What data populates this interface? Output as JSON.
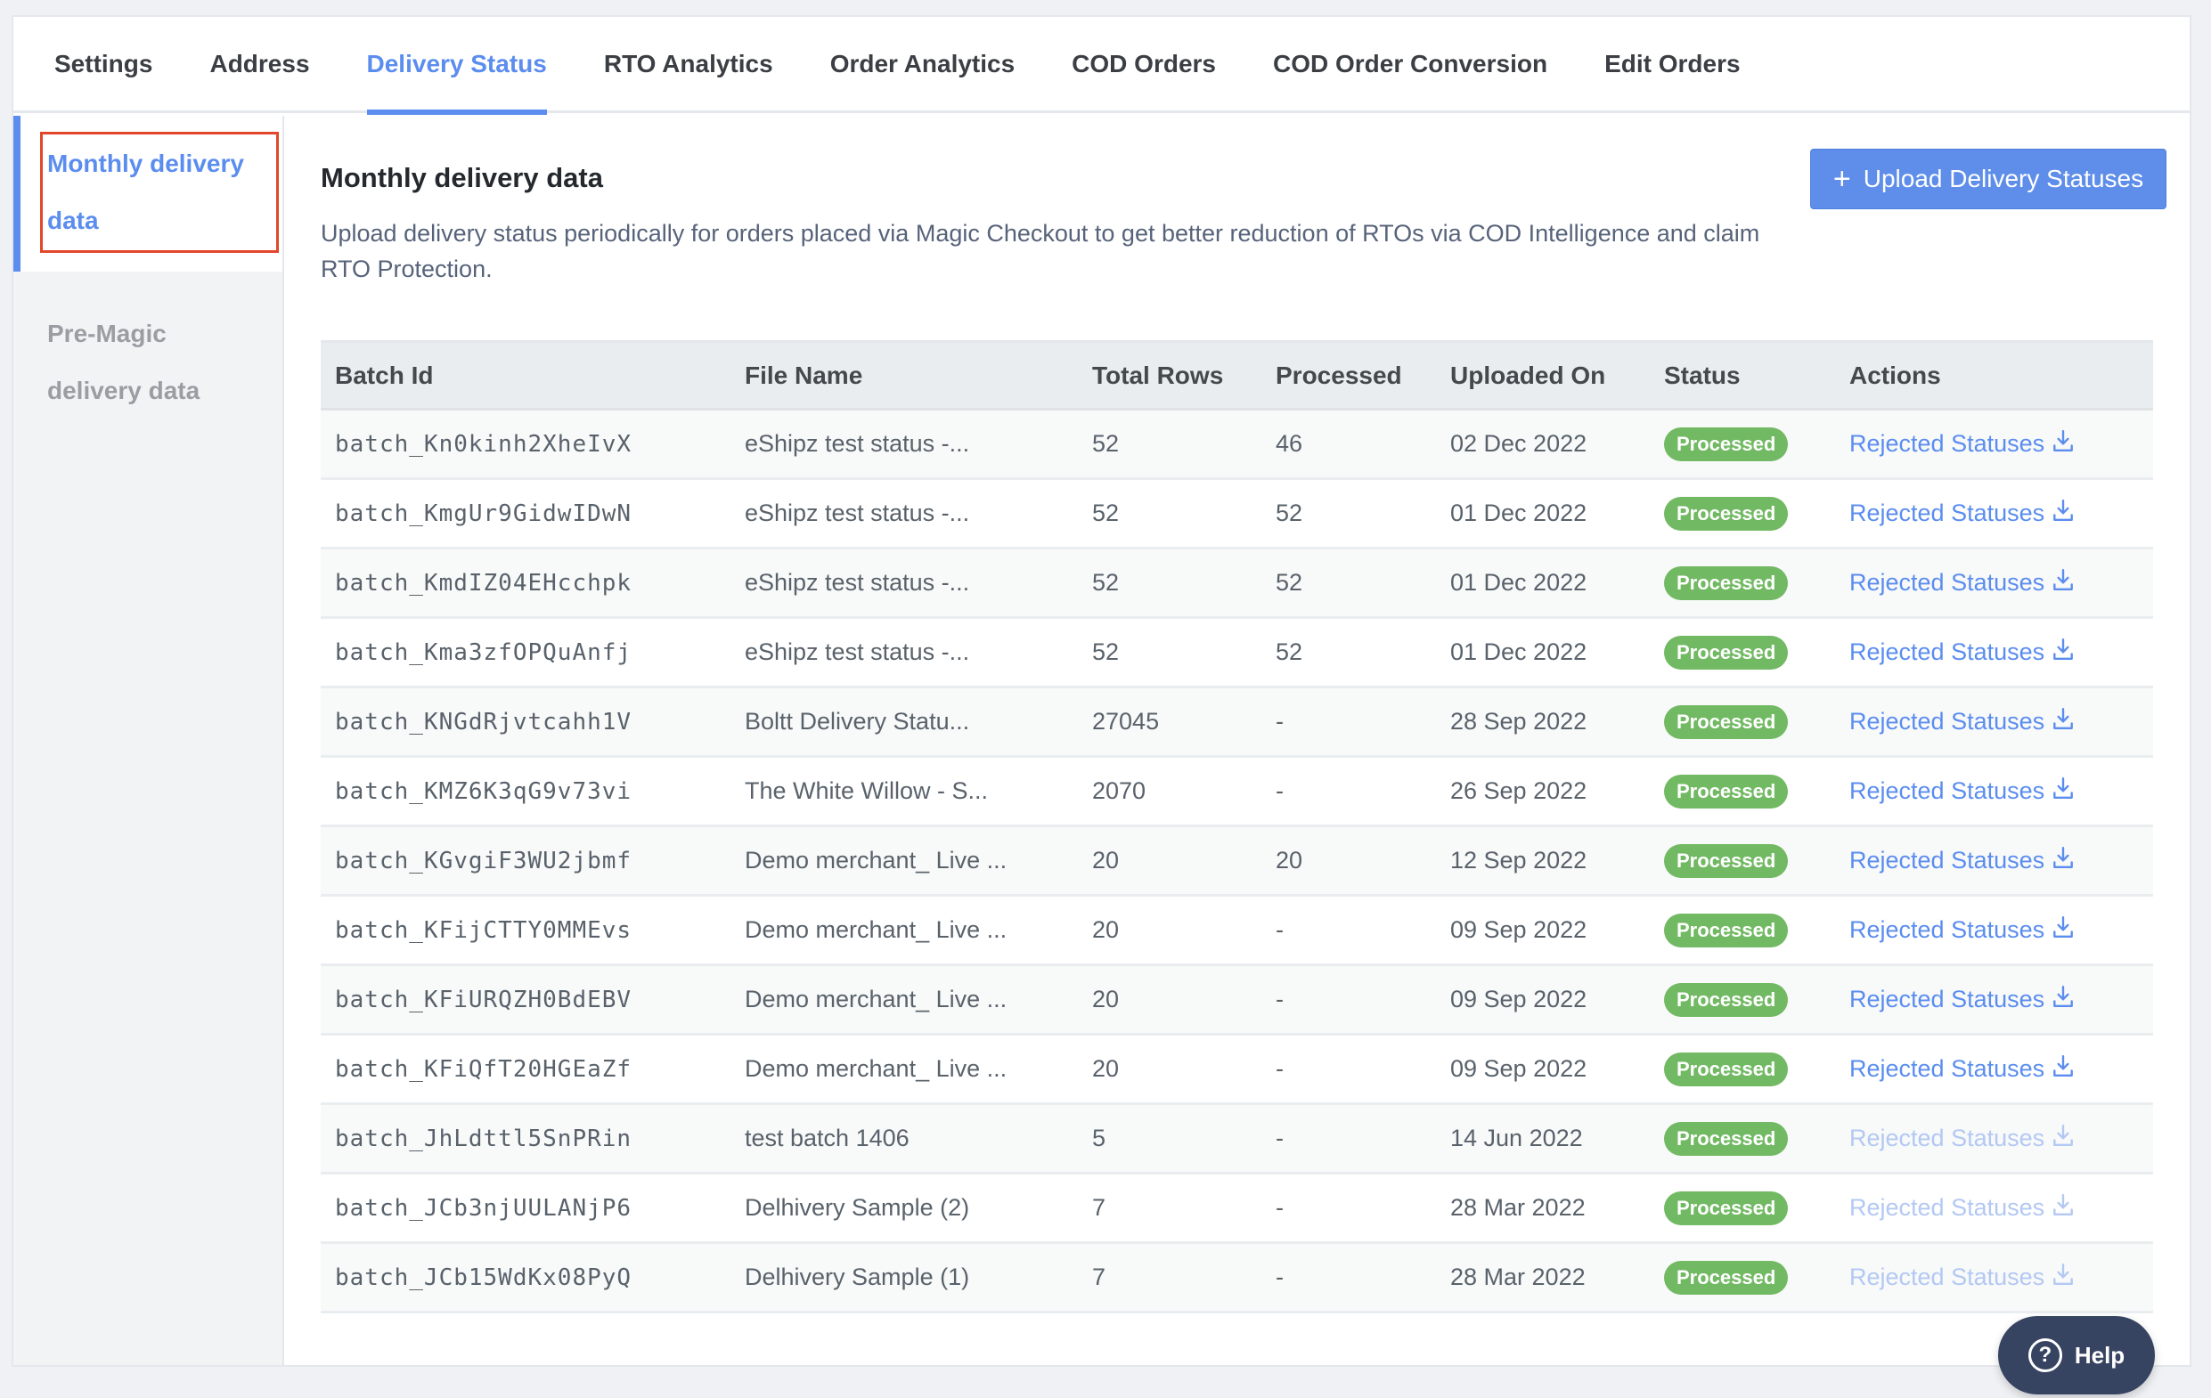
{
  "tabs": [
    {
      "label": "Settings",
      "active": false
    },
    {
      "label": "Address",
      "active": false
    },
    {
      "label": "Delivery Status",
      "active": true
    },
    {
      "label": "RTO Analytics",
      "active": false
    },
    {
      "label": "Order Analytics",
      "active": false
    },
    {
      "label": "COD Orders",
      "active": false
    },
    {
      "label": "COD Order Conversion",
      "active": false
    },
    {
      "label": "Edit Orders",
      "active": false
    }
  ],
  "sidebar": {
    "items": [
      {
        "label_line1": "Monthly delivery",
        "label_line2": "data",
        "active": true
      },
      {
        "label_line1": "Pre-Magic",
        "label_line2": "delivery data",
        "active": false
      }
    ]
  },
  "main": {
    "title": "Monthly delivery data",
    "description": "Upload delivery status periodically for orders placed via Magic Checkout to get better reduction of RTOs via COD Intelligence and claim RTO Protection.",
    "upload_button": {
      "icon": "plus-icon",
      "label": "Upload Delivery Statuses"
    },
    "table": {
      "columns": [
        "Batch Id",
        "File Name",
        "Total Rows",
        "Processed",
        "Uploaded On",
        "Status",
        "Actions"
      ],
      "rows": [
        {
          "batch_id": "batch_Kn0kinh2XheIvX",
          "file_name": "eShipz test status -...",
          "total_rows": "52",
          "processed": "46",
          "uploaded_on": "02 Dec 2022",
          "status": "Processed",
          "action": "Rejected Statuses",
          "action_enabled": true
        },
        {
          "batch_id": "batch_KmgUr9GidwIDwN",
          "file_name": "eShipz test status -...",
          "total_rows": "52",
          "processed": "52",
          "uploaded_on": "01 Dec 2022",
          "status": "Processed",
          "action": "Rejected Statuses",
          "action_enabled": true
        },
        {
          "batch_id": "batch_KmdIZ04EHcchpk",
          "file_name": "eShipz test status -...",
          "total_rows": "52",
          "processed": "52",
          "uploaded_on": "01 Dec 2022",
          "status": "Processed",
          "action": "Rejected Statuses",
          "action_enabled": true
        },
        {
          "batch_id": "batch_Kma3zfOPQuAnfj",
          "file_name": "eShipz test status -...",
          "total_rows": "52",
          "processed": "52",
          "uploaded_on": "01 Dec 2022",
          "status": "Processed",
          "action": "Rejected Statuses",
          "action_enabled": true
        },
        {
          "batch_id": "batch_KNGdRjvtcahh1V",
          "file_name": "Boltt Delivery Statu...",
          "total_rows": "27045",
          "processed": "-",
          "uploaded_on": "28 Sep 2022",
          "status": "Processed",
          "action": "Rejected Statuses",
          "action_enabled": true
        },
        {
          "batch_id": "batch_KMZ6K3qG9v73vi",
          "file_name": "The White Willow - S...",
          "total_rows": "2070",
          "processed": "-",
          "uploaded_on": "26 Sep 2022",
          "status": "Processed",
          "action": "Rejected Statuses",
          "action_enabled": true
        },
        {
          "batch_id": "batch_KGvgiF3WU2jbmf",
          "file_name": "Demo merchant_ Live ...",
          "total_rows": "20",
          "processed": "20",
          "uploaded_on": "12 Sep 2022",
          "status": "Processed",
          "action": "Rejected Statuses",
          "action_enabled": true
        },
        {
          "batch_id": "batch_KFijCTTY0MMEvs",
          "file_name": "Demo merchant_ Live ...",
          "total_rows": "20",
          "processed": "-",
          "uploaded_on": "09 Sep 2022",
          "status": "Processed",
          "action": "Rejected Statuses",
          "action_enabled": true
        },
        {
          "batch_id": "batch_KFiURQZH0BdEBV",
          "file_name": "Demo merchant_ Live ...",
          "total_rows": "20",
          "processed": "-",
          "uploaded_on": "09 Sep 2022",
          "status": "Processed",
          "action": "Rejected Statuses",
          "action_enabled": true
        },
        {
          "batch_id": "batch_KFiQfT20HGEaZf",
          "file_name": "Demo merchant_ Live ...",
          "total_rows": "20",
          "processed": "-",
          "uploaded_on": "09 Sep 2022",
          "status": "Processed",
          "action": "Rejected Statuses",
          "action_enabled": true
        },
        {
          "batch_id": "batch_JhLdttl5SnPRin",
          "file_name": "test batch 1406",
          "total_rows": "5",
          "processed": "-",
          "uploaded_on": "14 Jun 2022",
          "status": "Processed",
          "action": "Rejected Statuses",
          "action_enabled": false
        },
        {
          "batch_id": "batch_JCb3njUULANjP6",
          "file_name": "Delhivery Sample (2)",
          "total_rows": "7",
          "processed": "-",
          "uploaded_on": "28 Mar 2022",
          "status": "Processed",
          "action": "Rejected Statuses",
          "action_enabled": false
        },
        {
          "batch_id": "batch_JCb15WdKx08PyQ",
          "file_name": "Delhivery Sample (1)",
          "total_rows": "7",
          "processed": "-",
          "uploaded_on": "28 Mar 2022",
          "status": "Processed",
          "action": "Rejected Statuses",
          "action_enabled": false
        }
      ]
    }
  },
  "help_button": {
    "icon": "question-circle-icon",
    "label": "Help"
  },
  "colors": {
    "accent": "#5b8def",
    "success": "#72b963",
    "help_bg": "#374461",
    "highlight": "#e2472b"
  }
}
